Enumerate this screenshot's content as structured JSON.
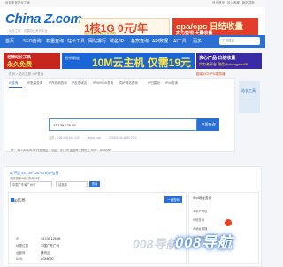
{
  "topbar": {
    "left": "欢迎来到站长之家",
    "right": "设为首页 | 加入收藏 | 网站导航"
  },
  "header": {
    "logo": "China Z.com",
    "logo_sub": "站长之家 · 中国站长资讯平台",
    "ad1_big": "1核1G 0元/年",
    "ad1_note": "免费云服务器 立即领取",
    "ad2_big": "cpa/cps 日结收量",
    "ad2_note": "实力变现 大量收量"
  },
  "nav": {
    "items": [
      "首页",
      "SEO查询",
      "权重查询",
      "站长工具",
      "网站排行",
      "域名/IP",
      "备案查询",
      "API数据",
      "AI工具",
      "更多"
    ],
    "search_placeholder": "工具搜索"
  },
  "banners": {
    "a1": "老牌站长工具",
    "a2": "永久免费",
    "b1": "秒杀到底",
    "b2": "10M云主机 仅需19元",
    "c1": "良心产品 日结收量",
    "c2": "实力老平台 微信@chengxun88"
  },
  "breadcrumb": {
    "path": "首页 > 站长工具 > IP查询",
    "right": "越南IDC/VPS/服务器"
  },
  "tabs": [
    "IP查询",
    "IP批量查询",
    "IP所在地查询",
    "IP反查域名",
    "IP WHOIS查询",
    "同IP网站查询",
    "IP归属地",
    "IPv6查询"
  ],
  "query": {
    "value": "43.139.126.95",
    "button": "立即查询",
    "hints": [
      "当前：106.246.154.123",
      "aliyun.com",
      "2408:8150:a030:23:2"
    ],
    "result_line": "IP：43.139.126.95   所在地区：中国广东广州   运营商：腾讯云   ASN：AS45090"
  },
  "sidebar": {
    "label": "站长工具"
  },
  "section": {
    "title": "以下是 43.139.126.95 的IP信息",
    "subtitle": "选择国家/地区查询IP段",
    "select1": "中国广东省广州市",
    "select2": "请选择",
    "select_button": "查询",
    "pane_title": "ip信息",
    "pane_button": "一键查询",
    "rows": [
      {
        "k": "IP",
        "v": "43.139.126.95"
      },
      {
        "k": "地理位置",
        "v": "中国广东广州"
      },
      {
        "k": "运营商",
        "v": "腾讯云"
      },
      {
        "k": "ASN",
        "v": "AS45090"
      }
    ],
    "right_title": "IPv4地址查询",
    "right_links": [
      "本机IP地址",
      "IP段查询",
      "IP地址转换",
      "IPv6转换"
    ]
  },
  "watermark": {
    "text": "008导航",
    "ghost": "008导航"
  }
}
